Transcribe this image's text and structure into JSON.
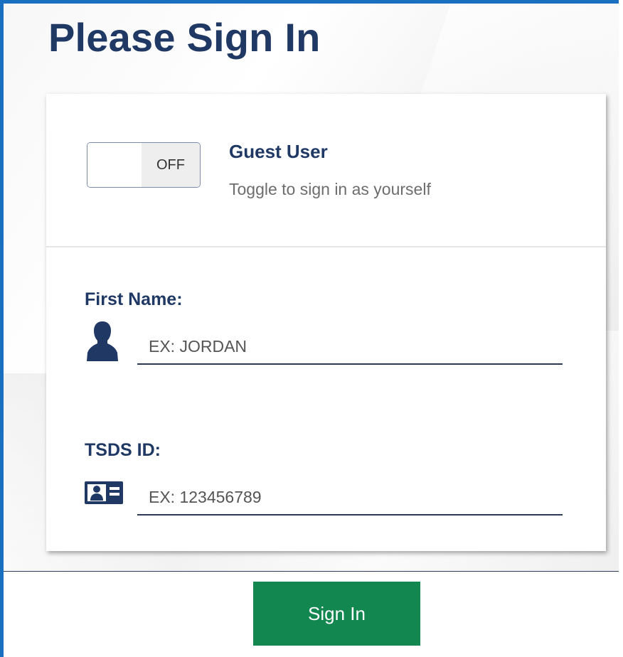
{
  "page": {
    "title": "Please Sign In"
  },
  "guest": {
    "toggle_state": "OFF",
    "title": "Guest User",
    "subtitle": "Toggle to sign in as yourself"
  },
  "fields": {
    "first_name": {
      "label": "First Name:",
      "placeholder": "EX: JORDAN",
      "value": "",
      "icon": "person-icon"
    },
    "tsds_id": {
      "label": "TSDS ID:",
      "placeholder": "EX: 123456789",
      "value": "",
      "icon": "id-card-icon"
    }
  },
  "actions": {
    "sign_in_label": "Sign In"
  },
  "colors": {
    "frame_border": "#1b6fc0",
    "heading": "#1f3864",
    "primary_button": "#128750"
  }
}
